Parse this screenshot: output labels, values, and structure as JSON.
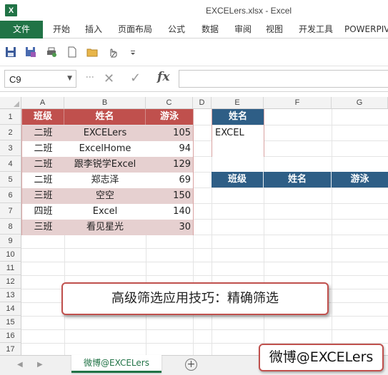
{
  "window": {
    "title": "EXCELers.xlsx - Excel",
    "app_icon": "X"
  },
  "ribbon": {
    "tabs": [
      "文件",
      "开始",
      "插入",
      "页面布局",
      "公式",
      "数据",
      "审阅",
      "视图",
      "开发工具",
      "POWERPIVOT"
    ]
  },
  "quick_access": {
    "icons": [
      "save-icon",
      "save-as-icon",
      "print-preview-icon",
      "new-document-icon",
      "open-folder-icon",
      "touch-mode-icon",
      "customize-dropdown-icon"
    ]
  },
  "formula_bar": {
    "name_box": "C9",
    "cancel_glyph": "✕",
    "enter_glyph": "✓",
    "fx_label": "fx",
    "formula": ""
  },
  "columns": [
    "A",
    "B",
    "C",
    "D",
    "E",
    "F",
    "G"
  ],
  "rows": [
    "1",
    "2",
    "3",
    "4",
    "5",
    "6",
    "7",
    "8",
    "9",
    "10",
    "11",
    "12",
    "13",
    "14",
    "15",
    "16",
    "17"
  ],
  "data_table": {
    "headers": [
      "班级",
      "姓名",
      "游泳"
    ],
    "rows": [
      [
        "二班",
        "EXCELers",
        "105"
      ],
      [
        "二班",
        "ExcelHome",
        "94"
      ],
      [
        "二班",
        "跟李锐学Excel",
        "129"
      ],
      [
        "二班",
        "郑志泽",
        "69"
      ],
      [
        "三班",
        "空空",
        "150"
      ],
      [
        "四班",
        "Excel",
        "140"
      ],
      [
        "三班",
        "看见星光",
        "30"
      ]
    ]
  },
  "criteria": {
    "header": "姓名",
    "value": "EXCEL",
    "blank": ""
  },
  "output_headers": [
    "班级",
    "姓名",
    "游泳"
  ],
  "banner": "高级筛选应用技巧：精确筛选",
  "sheet": {
    "tab_label": "微博@EXCELers",
    "prev": "◀",
    "next": "▶",
    "add": "+"
  },
  "watermark": "微博@EXCELers",
  "colors": {
    "excel_green": "#217346",
    "red_header": "#c0504d",
    "red_band": "#e6d0d0",
    "blue_header": "#2e5e86"
  }
}
